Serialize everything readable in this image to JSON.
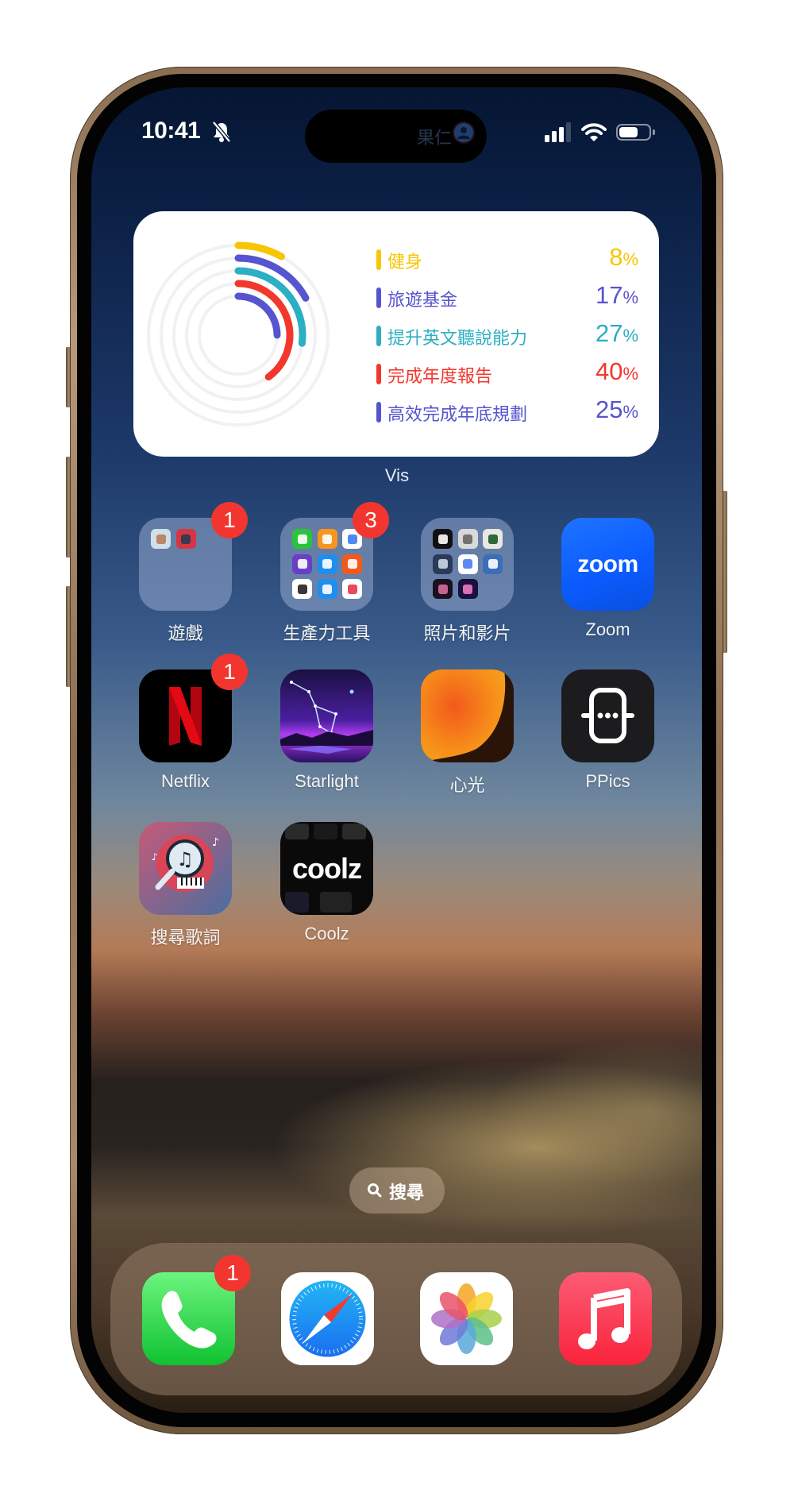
{
  "status_bar": {
    "time": "10:41",
    "silent_mode": true,
    "signal_bars_active": 3,
    "signal_bars_total": 4,
    "wifi": true,
    "battery_percent": 55
  },
  "dynamic_island": {
    "text": "果仁",
    "icon": "person-avatar-icon"
  },
  "widget": {
    "caption": "Vis",
    "chart_data": {
      "type": "radial-bar",
      "title": "",
      "series": [
        {
          "name": "健身",
          "value": 8,
          "color": "#F7C600"
        },
        {
          "name": "旅遊基金",
          "value": 17,
          "color": "#5754CF"
        },
        {
          "name": "提升英文聽說能力",
          "value": 27,
          "color": "#2BAFC2"
        },
        {
          "name": "完成年度報告",
          "value": 40,
          "color": "#F2382C"
        },
        {
          "name": "高效完成年底規劃",
          "value": 25,
          "color": "#5754CF"
        }
      ],
      "range": [
        0,
        100
      ],
      "unit": "%"
    }
  },
  "apps": [
    {
      "label": "遊戲",
      "type": "folder",
      "badge": "1",
      "mini": [
        {
          "bg": "#cfe0e8",
          "fg": "#b87c5c",
          "icon": "deer-character-game-icon"
        },
        {
          "bg": "#d63642",
          "fg": "#2a3a50",
          "icon": "building-game-icon"
        }
      ]
    },
    {
      "label": "生產力工具",
      "type": "folder",
      "badge": "3",
      "mini": [
        {
          "bg": "#2bc23e",
          "fg": "#ffffff",
          "icon": "numbers-icon"
        },
        {
          "bg": "#f7961e",
          "fg": "#ffffff",
          "icon": "pages-icon"
        },
        {
          "bg": "#ffffff",
          "fg": "#3b7cf0",
          "icon": "google-docs-icon"
        },
        {
          "bg": "#6a3fc6",
          "fg": "#ffffff",
          "icon": "imovie-icon"
        },
        {
          "bg": "#1d8ff0",
          "fg": "#ffffff",
          "icon": "keynote-icon"
        },
        {
          "bg": "#f25a1c",
          "fg": "#ffffff",
          "icon": "garageband-icon"
        },
        {
          "bg": "#ffffff",
          "fg": "#222222",
          "icon": "checklist-icon"
        },
        {
          "bg": "#1f8ef2",
          "fg": "#ffffff",
          "icon": "picsart-icon"
        },
        {
          "bg": "#ffffff",
          "fg": "#e8344e",
          "icon": "task-check-icon"
        }
      ]
    },
    {
      "label": "照片和影片",
      "type": "folder",
      "badge": "",
      "mini": [
        {
          "bg": "#111111",
          "fg": "#ffffff",
          "icon": "camera-lens-icon"
        },
        {
          "bg": "#d9d9d9",
          "fg": "#666666",
          "icon": "retro-camera-icon"
        },
        {
          "bg": "#e8e8e0",
          "fg": "#1a5a2a",
          "icon": "film-camera-icon"
        },
        {
          "bg": "#2a3a58",
          "fg": "#cfd8e8",
          "icon": "film-reel-icon"
        },
        {
          "bg": "#ffffff",
          "fg": "#4a7df5",
          "icon": "video-call-icon"
        },
        {
          "bg": "#3a6eb8",
          "fg": "#ffffff",
          "icon": "photo-camera-icon"
        },
        {
          "bg": "#1a1020",
          "fg": "#d86aa0",
          "icon": "wizard-hat-icon"
        },
        {
          "bg": "#1a1040",
          "fg": "#f07ac0",
          "icon": "octopus-icon"
        }
      ]
    },
    {
      "label": "Zoom",
      "type": "app",
      "badge": "",
      "icon": "zoom-icon",
      "icon_text": "zoom"
    },
    {
      "label": "Netflix",
      "type": "app",
      "badge": "1",
      "icon": "netflix-icon",
      "icon_text": "N"
    },
    {
      "label": "Starlight",
      "type": "app",
      "badge": "",
      "icon": "starlight-constellation-icon"
    },
    {
      "label": "心光",
      "type": "app",
      "badge": "",
      "icon": "sunlight-orb-icon"
    },
    {
      "label": "PPics",
      "type": "app",
      "badge": "",
      "icon": "ppics-device-icon"
    },
    {
      "label": "搜尋歌詞",
      "type": "app",
      "badge": "",
      "icon": "lyrics-search-icon"
    },
    {
      "label": "Coolz",
      "type": "app",
      "badge": "",
      "icon": "coolz-icon",
      "icon_text": "coolz"
    }
  ],
  "search": {
    "label": "搜尋",
    "icon": "search-icon"
  },
  "dock": [
    {
      "name": "Phone",
      "icon": "phone-icon",
      "badge": "1"
    },
    {
      "name": "Safari",
      "icon": "safari-compass-icon",
      "badge": ""
    },
    {
      "name": "Photos",
      "icon": "photos-flower-icon",
      "badge": ""
    },
    {
      "name": "Music",
      "icon": "music-note-icon",
      "badge": ""
    }
  ]
}
